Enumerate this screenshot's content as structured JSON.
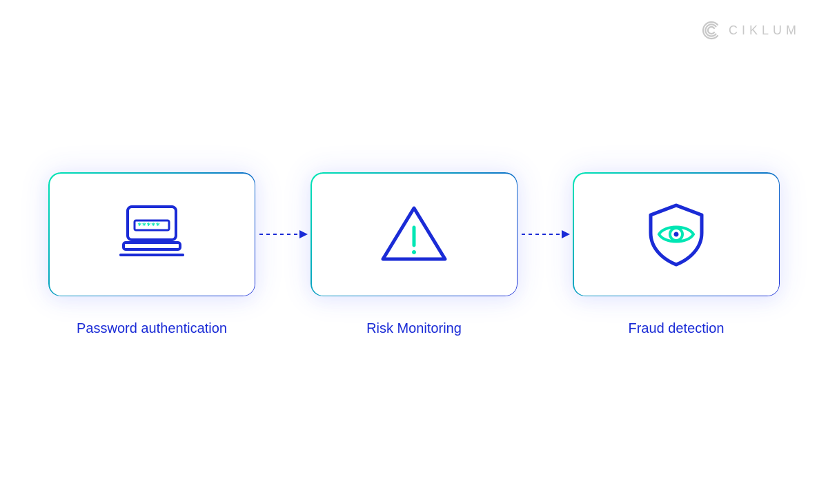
{
  "brand": {
    "name": "CIKLUM"
  },
  "flow": {
    "nodes": [
      {
        "label": "Password authentication",
        "icon": "laptop-password-icon"
      },
      {
        "label": "Risk Monitoring",
        "icon": "warning-triangle-icon"
      },
      {
        "label": "Fraud detection",
        "icon": "shield-eye-icon"
      }
    ]
  },
  "colors": {
    "primary": "#1a2bd6",
    "accent": "#00e6b4",
    "brand_muted": "#c8c8c8"
  }
}
